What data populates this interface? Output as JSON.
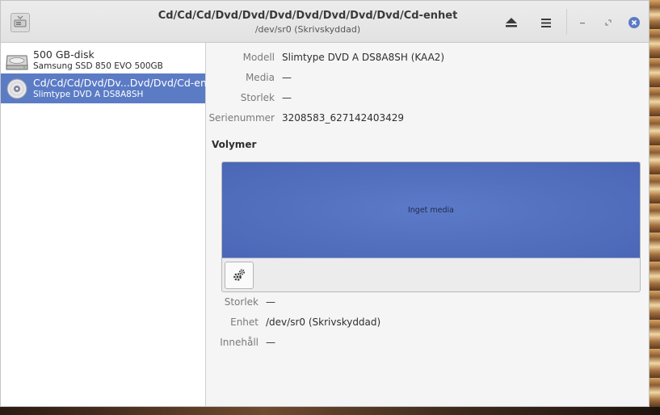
{
  "titlebar": {
    "title": "Cd/Cd/Cd/Dvd/Dvd/Dvd/Dvd/Dvd/Dvd/Dvd/Cd-enhet",
    "subtitle": "/dev/sr0 (Skrivskyddad)",
    "icons": [
      "disks-app-icon",
      "eject-icon",
      "hamburger-menu-icon",
      "minimize-icon",
      "maximize-icon",
      "close-icon"
    ]
  },
  "sidebar": {
    "items": [
      {
        "name": "500 GB-disk",
        "model": "Samsung SSD 850 EVO 500GB",
        "icon": "hard-disk-icon",
        "selected": false
      },
      {
        "name": "Cd/Cd/Cd/Dvd/Dv...Dvd/Dvd/Cd-enhet",
        "model": "Slimtype DVD A  DS8A8SH",
        "icon": "optical-disc-icon",
        "selected": true
      }
    ]
  },
  "drive_info": {
    "model_label": "Modell",
    "model_value": "Slimtype DVD A  DS8A8SH (KAA2)",
    "media_label": "Media",
    "media_value": "—",
    "size_label": "Storlek",
    "size_value": "—",
    "serial_label": "Serienummer",
    "serial_value": "3208583_627142403429"
  },
  "volumes": {
    "title": "Volymer",
    "empty_text": "Inget media",
    "size_label": "Storlek",
    "size_value": "—",
    "device_label": "Enhet",
    "device_value": "/dev/sr0 (Skrivskyddad)",
    "contents_label": "Innehåll",
    "contents_value": "—"
  },
  "colors": {
    "accent": "#5b7bc5",
    "volume_fill": "#4f6bbb"
  }
}
